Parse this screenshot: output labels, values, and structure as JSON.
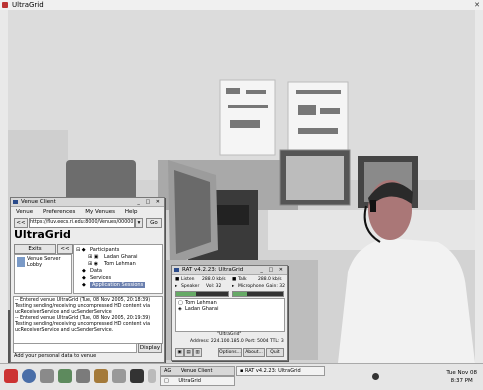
{
  "main_window": {
    "title": "UltraGrid"
  },
  "venue_client": {
    "title": "Venue Client",
    "menu": [
      "Venue",
      "Preferences",
      "My Venues",
      "Help"
    ],
    "back_label": "<<",
    "url": "https://fluv.eecs.ri.edu:8000/Venues/00000102",
    "go_label": "Go",
    "venue_name": "UltraGrid",
    "exits_label": "Exits",
    "exits_nav": "<<",
    "exits": [
      "Venue Server",
      "Lobby"
    ],
    "tree": {
      "participants_label": "Participants",
      "participants": [
        "Ladan Gharai",
        "Tom Lehman"
      ],
      "data_label": "Data",
      "services_label": "Services",
      "applications_label": "Application Sessions"
    },
    "log": [
      "-- Entered venue UltraGrid (Tue, 08 Nov 2005, 20:18:39)",
      "Testing sending/receiving uncompressed HD content via",
      "ucReceiverService and ucSenderService",
      "-- Entered venue UltraGrid (Tue, 08 Nov 2005, 20:19:39)",
      "Testing sending/receiving uncompressed HD content via",
      "ucReceiverService and ucSenderService."
    ],
    "display_label": "Display",
    "status": "Add your personal data to venue"
  },
  "rat": {
    "title": "RAT v4.2.23: UltraGrid",
    "listen_label": "Listen",
    "listen_value": "288.0 kb/s",
    "talk_label": "Talk",
    "talk_value": "288.0 kb/s",
    "speaker_label": "Speaker",
    "speaker_vol": "Vol: 32",
    "mic_label": "Microphone",
    "mic_gain": "Gain: 32",
    "participants": [
      "Tom Lehman",
      "Ladan Gharai"
    ],
    "session": "\"UltraGrid\"",
    "address": "Address: 224.100.185.0  Port: 5004  TTL: 3",
    "buttons": [
      "Options...",
      "About...",
      "Quit"
    ]
  },
  "taskbar": {
    "tasks": [
      {
        "label": "Venue Client",
        "prefix": "AG"
      },
      {
        "label": "RAT v4.2.23: UltraGrid",
        "prefix": ""
      },
      {
        "label": "UltraGrid",
        "prefix": ""
      }
    ],
    "clock_date": "Tue Nov 08",
    "clock_time": "8:37 PM"
  }
}
